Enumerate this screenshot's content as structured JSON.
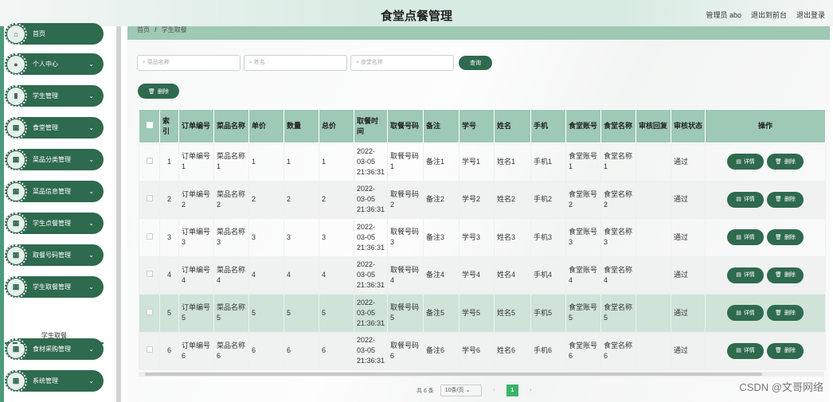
{
  "header": {
    "title": "食堂点餐管理",
    "user": "管理员 abo",
    "back_front": "退出到前台",
    "logout": "退出登录"
  },
  "menu": [
    {
      "label": "首页",
      "icon": "home-icon",
      "glyph": "⌂",
      "arrow": false
    },
    {
      "label": "个人中心",
      "icon": "person-icon",
      "glyph": "●",
      "arrow": true
    },
    {
      "label": "学生管理",
      "icon": "chart-icon",
      "glyph": "▮",
      "arrow": true
    },
    {
      "label": "食堂管理",
      "icon": "grid-icon",
      "glyph": "▦",
      "arrow": true
    },
    {
      "label": "菜品分类管理",
      "icon": "grid-icon",
      "glyph": "▦",
      "arrow": true
    },
    {
      "label": "菜品信息管理",
      "icon": "grid-icon",
      "glyph": "▦",
      "arrow": true
    },
    {
      "label": "学生点餐管理",
      "icon": "grid-icon",
      "glyph": "▦",
      "arrow": true
    },
    {
      "label": "取餐号码管理",
      "icon": "grid-icon",
      "glyph": "▦",
      "arrow": true
    },
    {
      "label": "学生取餐管理",
      "icon": "grid-icon",
      "glyph": "▦",
      "arrow": true
    },
    {
      "label": "食材采购管理",
      "icon": "grid-icon",
      "glyph": "▦",
      "arrow": true
    },
    {
      "label": "系统管理",
      "icon": "grid-icon",
      "glyph": "▦",
      "arrow": true
    }
  ],
  "submenu": {
    "label": "学生取餐"
  },
  "breadcrumb": {
    "home": "首页",
    "sep": "/",
    "current": "学生取餐"
  },
  "search": {
    "dish": "菜品名称",
    "name": "姓名",
    "canteen": "食堂名称",
    "button": "查询"
  },
  "toolbar": {
    "delete": "删除"
  },
  "table": {
    "headers": [
      "索引",
      "订单编号",
      "菜品名称",
      "单价",
      "数量",
      "总价",
      "取餐时间",
      "取餐号码",
      "备注",
      "学号",
      "姓名",
      "手机",
      "食堂账号",
      "食堂名称",
      "审核回复",
      "审核状态",
      "操作"
    ],
    "rows": [
      {
        "idx": "1",
        "order": "订单编号1",
        "dish": "菜品名称1",
        "price": "1",
        "qty": "1",
        "total": "1",
        "time": "2022-03-05 21:36:31",
        "code": "取餐号码1",
        "note": "备注1",
        "sid": "学号1",
        "name": "姓名1",
        "phone": "手机1",
        "acct": "食堂账号1",
        "cname": "食堂名称1",
        "reply": "",
        "status": "通过"
      },
      {
        "idx": "2",
        "order": "订单编号2",
        "dish": "菜品名称2",
        "price": "2",
        "qty": "2",
        "total": "2",
        "time": "2022-03-05 21:36:31",
        "code": "取餐号码2",
        "note": "备注2",
        "sid": "学号2",
        "name": "姓名2",
        "phone": "手机2",
        "acct": "食堂账号2",
        "cname": "食堂名称2",
        "reply": "",
        "status": "通过"
      },
      {
        "idx": "3",
        "order": "订单编号3",
        "dish": "菜品名称3",
        "price": "3",
        "qty": "3",
        "total": "3",
        "time": "2022-03-05 21:36:31",
        "code": "取餐号码3",
        "note": "备注3",
        "sid": "学号3",
        "name": "姓名3",
        "phone": "手机3",
        "acct": "食堂账号3",
        "cname": "食堂名称3",
        "reply": "",
        "status": "通过"
      },
      {
        "idx": "4",
        "order": "订单编号4",
        "dish": "菜品名称4",
        "price": "4",
        "qty": "4",
        "total": "4",
        "time": "2022-03-05 21:36:31",
        "code": "取餐号码4",
        "note": "备注4",
        "sid": "学号4",
        "name": "姓名4",
        "phone": "手机4",
        "acct": "食堂账号4",
        "cname": "食堂名称4",
        "reply": "",
        "status": "通过"
      },
      {
        "idx": "5",
        "order": "订单编号5",
        "dish": "菜品名称5",
        "price": "5",
        "qty": "5",
        "total": "5",
        "time": "2022-03-05 21:36:31",
        "code": "取餐号码5",
        "note": "备注5",
        "sid": "学号5",
        "name": "姓名5",
        "phone": "手机5",
        "acct": "食堂账号5",
        "cname": "食堂名称5",
        "reply": "",
        "status": "通过"
      },
      {
        "idx": "6",
        "order": "订单编号6",
        "dish": "菜品名称6",
        "price": "6",
        "qty": "6",
        "total": "6",
        "time": "2022-03-05 21:36:31",
        "code": "取餐号码6",
        "note": "备注6",
        "sid": "学号6",
        "name": "姓名6",
        "phone": "手机6",
        "acct": "食堂账号6",
        "cname": "食堂名称6",
        "reply": "",
        "status": "通过"
      }
    ],
    "detail_label": "详情",
    "delete_label": "删除"
  },
  "pager": {
    "total": "共 6 条",
    "size": "10条/页",
    "prev": "‹",
    "page": "1",
    "next": "›"
  },
  "watermark": "CSDN @文哥网络",
  "colors": {
    "primary": "#2e6a4e",
    "header_row": "#9ec9b4",
    "active_page": "#3bb36a"
  }
}
